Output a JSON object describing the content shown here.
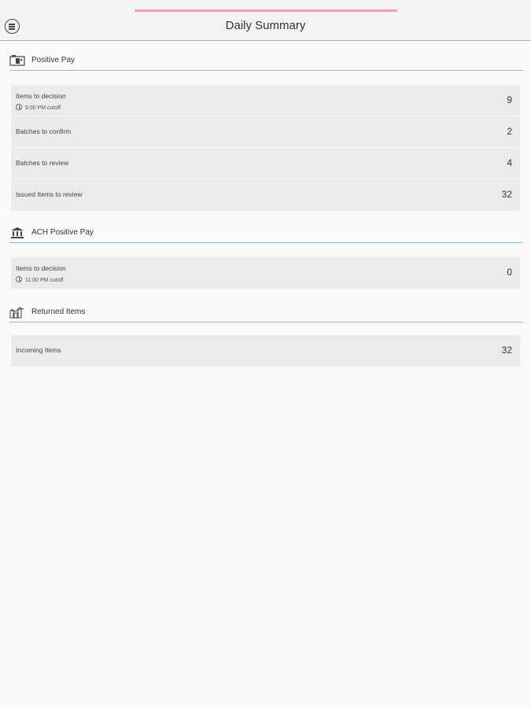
{
  "header": {
    "title": "Daily Summary",
    "menu_icon": "hamburger-circle-icon",
    "accent_color": "#e6a3b0",
    "divider_color": "#8fb5d9"
  },
  "sections": [
    {
      "label": "Positive Pay",
      "icon": "check-camera-icon",
      "rows": [
        {
          "label": "Items to decision",
          "sub": "5:00 PM cutoff",
          "value": "9"
        },
        {
          "label": "Batches to confirm",
          "value": "2"
        },
        {
          "label": "Batches to review",
          "value": "4"
        },
        {
          "label": "Issued Items to review",
          "value": "32"
        }
      ]
    },
    {
      "label": "ACH Positive Pay",
      "icon": "bank-building-icon",
      "rows": [
        {
          "label": "Items to decision",
          "sub": "11:00 PM cutoff",
          "value": "0"
        }
      ]
    },
    {
      "label": "Returned Items",
      "icon": "returned-chart-icon",
      "rows": [
        {
          "label": "Incoming Items",
          "value": "32"
        }
      ]
    }
  ]
}
